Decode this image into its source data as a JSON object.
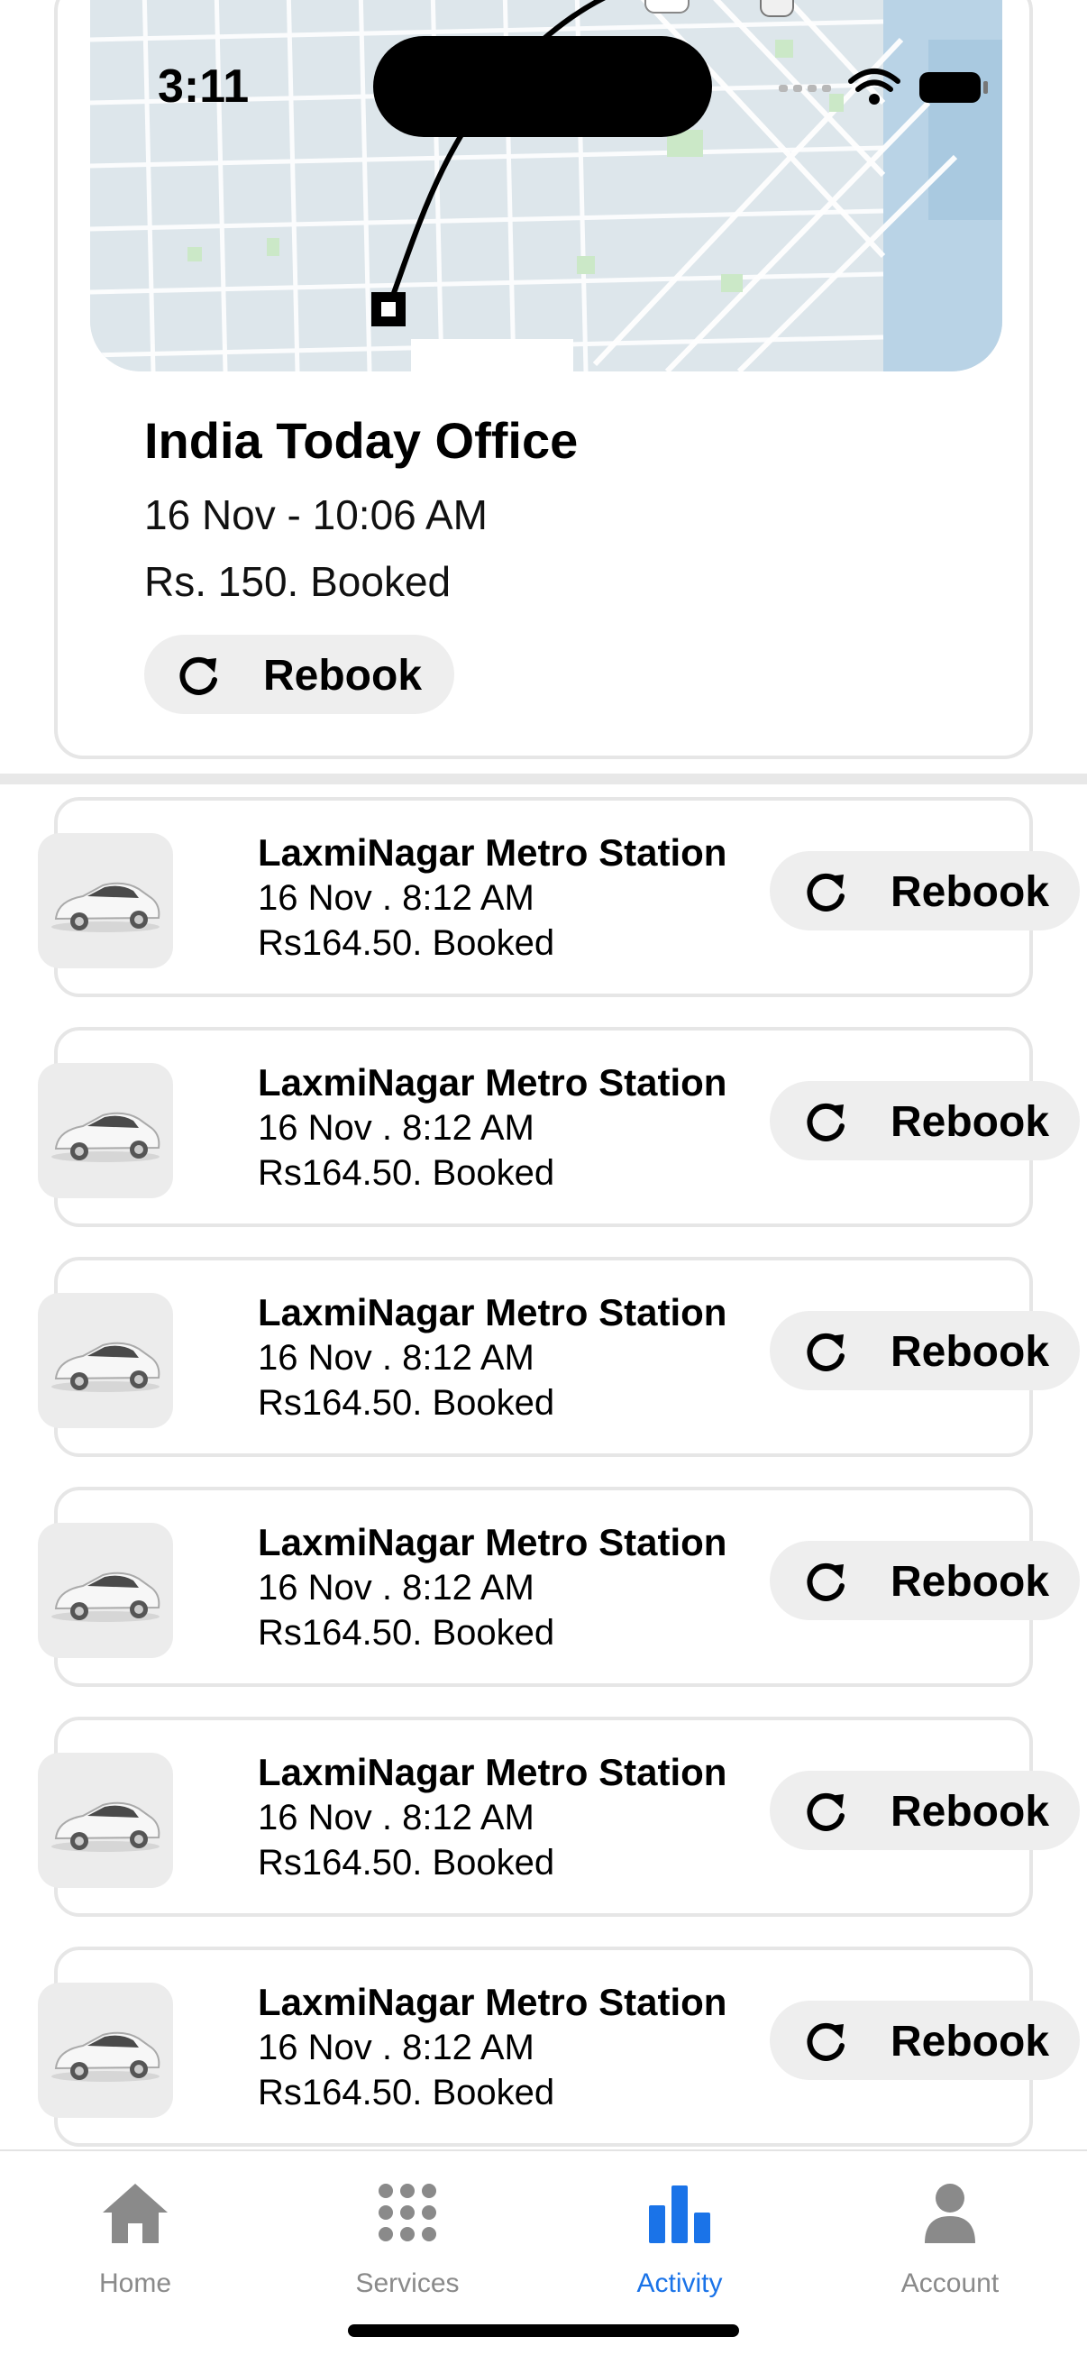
{
  "status_bar": {
    "time": "3:11"
  },
  "featured": {
    "title": "India Today Office",
    "date": "16 Nov - 10:06 AM",
    "price": "Rs. 150. Booked",
    "rebook_label": "Rebook"
  },
  "rides": [
    {
      "title": "LaxmiNagar Metro Station",
      "date": "16 Nov . 8:12 AM",
      "price": "Rs164.50. Booked",
      "rebook_label": "Rebook"
    },
    {
      "title": "LaxmiNagar Metro Station",
      "date": "16 Nov . 8:12 AM",
      "price": "Rs164.50. Booked",
      "rebook_label": "Rebook"
    },
    {
      "title": "LaxmiNagar Metro Station",
      "date": "16 Nov . 8:12 AM",
      "price": "Rs164.50. Booked",
      "rebook_label": "Rebook"
    },
    {
      "title": "LaxmiNagar Metro Station",
      "date": "16 Nov . 8:12 AM",
      "price": "Rs164.50. Booked",
      "rebook_label": "Rebook"
    },
    {
      "title": "LaxmiNagar Metro Station",
      "date": "16 Nov . 8:12 AM",
      "price": "Rs164.50. Booked",
      "rebook_label": "Rebook"
    },
    {
      "title": "LaxmiNagar Metro Station",
      "date": "16 Nov . 8:12 AM",
      "price": "Rs164.50. Booked",
      "rebook_label": "Rebook"
    }
  ],
  "nav": {
    "items": [
      {
        "label": "Home",
        "icon": "home-icon",
        "active": false
      },
      {
        "label": "Services",
        "icon": "grid-icon",
        "active": false
      },
      {
        "label": "Activity",
        "icon": "bar-chart-icon",
        "active": true
      },
      {
        "label": "Account",
        "icon": "person-icon",
        "active": false
      }
    ]
  },
  "colors": {
    "accent": "#1a73e8",
    "inactive": "#8a8a8a",
    "pill": "#eeeeee"
  }
}
